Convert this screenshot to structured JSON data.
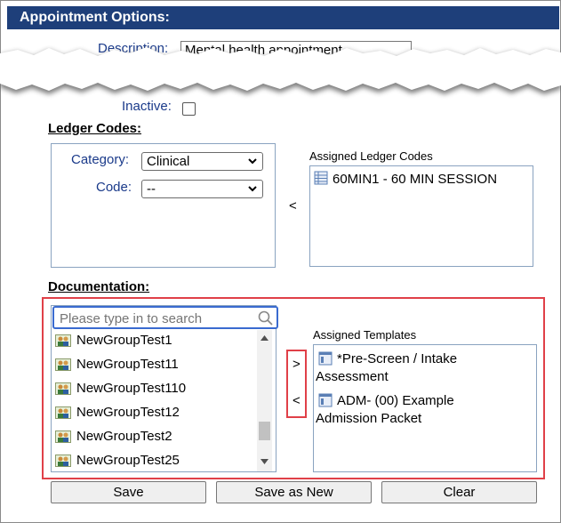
{
  "header": {
    "title": "Appointment Options:"
  },
  "partial": {
    "description_label": "Description:",
    "description_value": "Mental health appointment"
  },
  "inactive": {
    "label": "Inactive:",
    "checked": false
  },
  "ledger": {
    "title": "Ledger Codes:",
    "category_label": "Category:",
    "category_value": "Clinical",
    "code_label": "Code:",
    "code_value": "--",
    "arrow_label": "<",
    "assigned_label": "Assigned Ledger Codes",
    "assigned_items": [
      "60MIN1 - 60 MIN SESSION"
    ]
  },
  "documentation": {
    "title": "Documentation:",
    "search_placeholder": "Please type in to search",
    "list_items": [
      "NewGroupTest1",
      "NewGroupTest11",
      "NewGroupTest110",
      "NewGroupTest12",
      "NewGroupTest2",
      "NewGroupTest25"
    ],
    "add_label": ">",
    "remove_label": "<",
    "assigned_label": "Assigned Templates",
    "assigned_templates": [
      {
        "line1": "*Pre-Screen / Intake",
        "line2": "Assessment"
      },
      {
        "line1": "ADM- (00) Example",
        "line2": "Admission Packet"
      }
    ]
  },
  "buttons": {
    "save": "Save",
    "save_as_new": "Save as New",
    "clear": "Clear"
  },
  "colors": {
    "header_bg": "#1e3f7a",
    "highlight": "#e04048",
    "label_blue": "#1a3a8a"
  }
}
